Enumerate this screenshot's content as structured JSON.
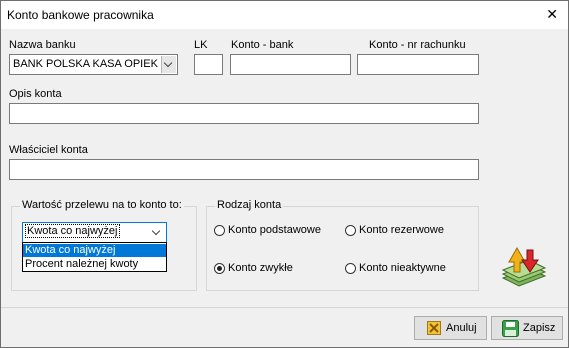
{
  "window": {
    "title": "Konto bankowe pracownika"
  },
  "labels": {
    "bank_name": "Nazwa banku",
    "lk": "LK",
    "account_bank": "Konto - bank",
    "account_number": "Konto - nr rachunku",
    "description": "Opis konta",
    "owner": "Właściciel konta"
  },
  "fields": {
    "bank_name_value": "BANK POLSKA KASA OPIEKI S",
    "lk": "",
    "account_bank": "",
    "account_number": "",
    "description": "",
    "owner": ""
  },
  "transfer_group": {
    "caption": "Wartość przelewu na to konto to:",
    "selected": "Kwota co najwyżej",
    "options": [
      "Kwota co najwyżej",
      "Procent należnej kwoty"
    ]
  },
  "account_type_group": {
    "caption": "Rodzaj konta",
    "options": [
      {
        "label": "Konto podstawowe",
        "checked": false
      },
      {
        "label": "Konto rezerwowe",
        "checked": false
      },
      {
        "label": "Konto zwykłe",
        "checked": true
      },
      {
        "label": "Konto nieaktywne",
        "checked": false
      }
    ]
  },
  "buttons": {
    "cancel": "Anuluj",
    "save": "Zapisz"
  },
  "icons": {
    "close": "close-icon",
    "money": "money-transfer-icon",
    "cancel": "cancel-icon",
    "save": "save-icon"
  },
  "colors": {
    "selection": "#0078d7",
    "window_bg": "#f0f0f0",
    "titlebar_bg": "#ffffff"
  }
}
